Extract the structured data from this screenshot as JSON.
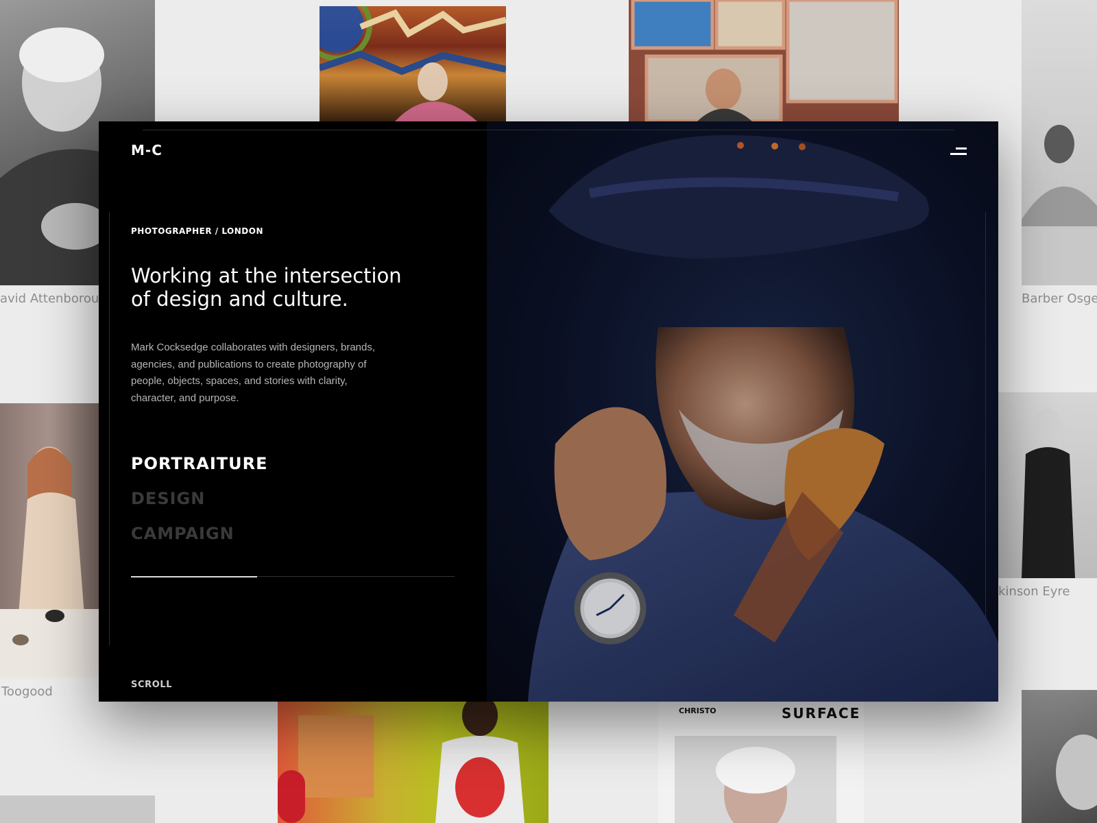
{
  "site": {
    "logo": "M-C",
    "menu_icon": "menu-icon",
    "eyebrow": "PHOTOGRAPHER / LONDON",
    "headline": "Working at the intersection of design and culture.",
    "intro": "Mark Cocksedge collaborates with designers, brands, agencies, and publications to create photography of people, objects, spaces, and stories with clarity, character, and purpose.",
    "categories": [
      {
        "label": "PORTRAITURE",
        "active": true
      },
      {
        "label": "DESIGN",
        "active": false
      },
      {
        "label": "CAMPAIGN",
        "active": false
      }
    ],
    "progress": 0.39,
    "scroll_label": "SCROLL"
  },
  "background_captions": {
    "top_left": "avid Attenboroug",
    "top_right": "Barber Osge",
    "mid_left": "Toogood",
    "mid_right": "kinson Eyre"
  },
  "magazine": {
    "left_text": "CHRISTO",
    "right_text": "SURFACE"
  },
  "colors": {
    "page_background": "#ececec",
    "card_background": "#000000",
    "category_active": "#ffffff",
    "category_inactive": "#3a3a3a",
    "caption_gray": "#8e8e8e"
  }
}
